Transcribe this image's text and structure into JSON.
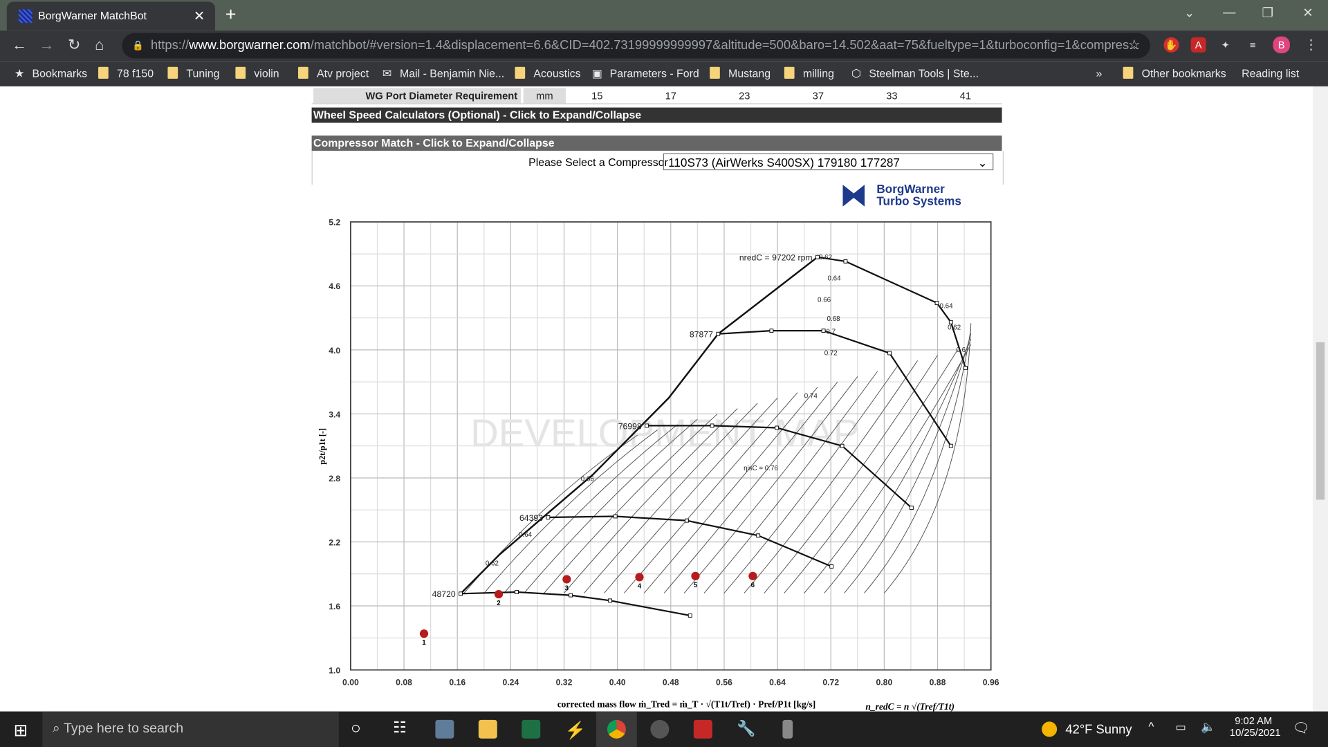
{
  "browser": {
    "tab_title": "BorgWarner MatchBot",
    "url_prefix": "https://",
    "url_domain": "www.borgwarner.com",
    "url_rest": "/matchbot/#version=1.4&displacement=6.6&CID=402.73199999999997&altitude=500&baro=14.502&aat=75&fueltype=1&turboconfig=1&compres...",
    "profile_initial": "B"
  },
  "bookmarks": [
    {
      "label": "Bookmarks",
      "icon": "star-icon"
    },
    {
      "label": "78 f150",
      "icon": "folder-icon"
    },
    {
      "label": "Tuning",
      "icon": "folder-icon"
    },
    {
      "label": "violin",
      "icon": "folder-icon"
    },
    {
      "label": "Atv project",
      "icon": "folder-icon"
    },
    {
      "label": "Mail - Benjamin Nie...",
      "icon": "outlook-icon"
    },
    {
      "label": "Acoustics",
      "icon": "folder-icon"
    },
    {
      "label": "Parameters - Ford",
      "icon": "hp-icon"
    },
    {
      "label": "Mustang",
      "icon": "folder-icon"
    },
    {
      "label": "milling",
      "icon": "folder-icon"
    },
    {
      "label": "Steelman Tools | Ste...",
      "icon": "steelman-icon"
    }
  ],
  "bookmarks_more": "»",
  "other_bookmarks": "Other bookmarks",
  "reading_list": "Reading list",
  "page": {
    "partial_row_label": "WG Port Diameter Requirement",
    "partial_row_unit": "mm",
    "partial_row_values": [
      "15",
      "17",
      "23",
      "37",
      "33",
      "41"
    ],
    "wheel_speed_header": "Wheel Speed Calculators (Optional) - Click to Expand/Collapse",
    "compressor_header": "Compressor Match - Click to Expand/Collapse",
    "compressor_label": "Please Select a Compressor",
    "compressor_value": "110S73 (AirWerks S400SX) 179180 177287",
    "logo_line1": "BorgWarner",
    "logo_line2": "Turbo Systems",
    "watermark": "DEVELOPMENT MAP",
    "colors": {
      "header_dark": "#333333",
      "header_mid": "#666666",
      "point": "#b71c1c"
    }
  },
  "chart_data": {
    "type": "scatter",
    "xlabel": "corrected mass flow  ṁ_Tred = ṁ_T · √(T1t/Tref) · Pref/P1t  [kg/s]",
    "xlabel2": "n_redC = n √(Tref/T1t)",
    "ylabel": "p2t/p1t [-]",
    "xlim": [
      0,
      0.96
    ],
    "ylim": [
      1.0,
      5.2
    ],
    "grid": true,
    "xticks": [
      "0.00",
      "0.08",
      "0.16",
      "0.24",
      "0.32",
      "0.40",
      "0.48",
      "0.56",
      "0.64",
      "0.72",
      "0.80",
      "0.88",
      "0.96"
    ],
    "yticks": [
      "1.0",
      "1.6",
      "2.2",
      "2.8",
      "3.4",
      "4.0",
      "4.6",
      "5.2"
    ],
    "operating_points": [
      {
        "label": "1",
        "x": 0.11,
        "y": 1.34
      },
      {
        "label": "2",
        "x": 0.222,
        "y": 1.71
      },
      {
        "label": "3",
        "x": 0.324,
        "y": 1.85
      },
      {
        "label": "4",
        "x": 0.433,
        "y": 1.87
      },
      {
        "label": "5",
        "x": 0.517,
        "y": 1.88
      },
      {
        "label": "6",
        "x": 0.603,
        "y": 1.88
      }
    ],
    "speed_lines": [
      {
        "label": "48720",
        "x": [
          0.165,
          0.249,
          0.33,
          0.389,
          0.509
        ],
        "y": [
          1.715,
          1.73,
          1.7,
          1.65,
          1.51
        ]
      },
      {
        "label": "64393",
        "x": [
          0.296,
          0.397,
          0.504,
          0.611,
          0.721
        ],
        "y": [
          2.43,
          2.44,
          2.4,
          2.26,
          1.97
        ]
      },
      {
        "label": "76998",
        "x": [
          0.444,
          0.542,
          0.639,
          0.737,
          0.841
        ],
        "y": [
          3.29,
          3.29,
          3.27,
          3.1,
          2.52
        ]
      },
      {
        "label": "87877",
        "x": [
          0.551,
          0.631,
          0.709,
          0.808,
          0.9
        ],
        "y": [
          4.15,
          4.18,
          4.18,
          3.97,
          3.1
        ]
      },
      {
        "label": "nredC = 97202 rpm",
        "x": [
          0.7,
          0.742,
          0.879,
          0.9,
          0.922
        ],
        "y": [
          4.87,
          4.83,
          4.44,
          4.26,
          3.83
        ]
      }
    ],
    "surge_line": {
      "x": [
        0.165,
        0.223,
        0.363,
        0.477,
        0.551,
        0.7
      ],
      "y": [
        1.715,
        2.08,
        2.83,
        3.55,
        4.15,
        4.87
      ]
    },
    "efficiency_labels": [
      {
        "t": "0.62",
        "x": 0.212,
        "y": 1.98
      },
      {
        "t": "0.64",
        "x": 0.262,
        "y": 2.25
      },
      {
        "t": "0.66",
        "x": 0.355,
        "y": 2.77
      },
      {
        "t": "ηisC = 0.76",
        "x": 0.615,
        "y": 2.87
      },
      {
        "t": "0.74",
        "x": 0.69,
        "y": 3.55
      },
      {
        "t": "0.72",
        "x": 0.72,
        "y": 3.95
      },
      {
        "t": "0.7",
        "x": 0.72,
        "y": 4.15
      },
      {
        "t": "0.68",
        "x": 0.724,
        "y": 4.27
      },
      {
        "t": "0.66",
        "x": 0.71,
        "y": 4.45
      },
      {
        "t": "0.64",
        "x": 0.725,
        "y": 4.65
      },
      {
        "t": "0.62",
        "x": 0.712,
        "y": 4.85
      },
      {
        "t": "0.64",
        "x": 0.893,
        "y": 4.39
      },
      {
        "t": "0.62",
        "x": 0.905,
        "y": 4.19
      },
      {
        "t": "0.6",
        "x": 0.915,
        "y": 3.98
      }
    ]
  }
}
